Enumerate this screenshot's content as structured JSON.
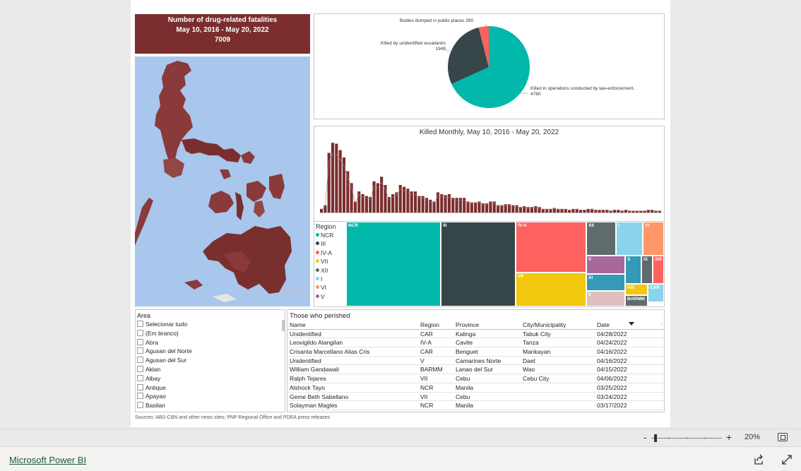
{
  "title_card": {
    "line1": "Number of drug-related fatalities",
    "line2": "May 10, 2016 - May 20, 2022",
    "total": "7009"
  },
  "colors": {
    "title_bg": "#7b2d2d",
    "bar": "#7b2d2d",
    "teal": "#01b8aa",
    "dark": "#374649",
    "red": "#fd625e",
    "yellow": "#f2c80f",
    "map_sea": "#a9c6ec"
  },
  "pie": {
    "labels": {
      "public": "Bodies dumped in public places 280",
      "assailant_line1": "Killed by unidentified assailant/s",
      "assailant_line2": "1949",
      "operations_line1": "Killed in operations conducted by law-enforcement..",
      "operations_line2": "4780"
    }
  },
  "chart_data": [
    {
      "type": "pie",
      "categories": [
        "Killed in operations conducted by law-enforcement..",
        "Killed by unidentified assailant/s",
        "Bodies dumped in public places"
      ],
      "values": [
        4780,
        1949,
        280
      ],
      "colors": [
        "#01b8aa",
        "#374649",
        "#fd625e"
      ]
    },
    {
      "type": "bar",
      "title": "Killed Monthly, May 10, 2016 - May 20, 2022",
      "values": [
        20,
        40,
        325,
        380,
        375,
        340,
        300,
        225,
        160,
        60,
        115,
        100,
        90,
        85,
        170,
        160,
        195,
        150,
        85,
        100,
        110,
        150,
        140,
        130,
        115,
        115,
        90,
        90,
        80,
        70,
        60,
        110,
        100,
        95,
        100,
        80,
        80,
        80,
        80,
        60,
        55,
        55,
        60,
        50,
        50,
        60,
        60,
        40,
        40,
        45,
        45,
        40,
        40,
        30,
        35,
        30,
        30,
        35,
        30,
        20,
        20,
        20,
        25,
        20,
        20,
        20,
        15,
        20,
        20,
        15,
        15,
        20,
        20,
        15,
        15,
        15,
        15,
        10,
        15,
        15,
        10,
        15,
        10,
        10,
        10,
        10,
        10,
        15,
        15,
        10,
        10
      ],
      "series": [
        {
          "values": [
            20,
            40,
            325,
            380,
            375,
            340,
            300,
            225,
            160,
            60,
            115,
            100,
            90,
            85,
            170,
            160,
            195,
            150,
            85,
            100,
            110,
            150,
            140,
            130,
            115,
            115,
            90,
            90,
            80,
            70,
            60,
            110,
            100,
            95,
            100,
            80,
            80,
            80,
            80,
            60,
            55,
            55,
            60,
            50,
            50,
            60,
            60,
            40,
            40,
            45,
            45,
            40,
            40,
            30,
            35,
            30,
            30,
            35,
            30,
            20,
            20,
            20,
            25,
            20,
            20,
            20,
            15,
            20,
            20,
            15,
            15,
            20,
            20,
            15,
            15,
            15,
            15,
            10,
            15,
            15,
            10,
            15,
            10,
            10,
            10,
            10,
            10,
            15,
            15,
            10,
            10
          ]
        }
      ],
      "ylim": [
        0,
        400
      ]
    },
    {
      "type": "treemap",
      "categories": [
        "NCR",
        "III",
        "IV-A",
        "VII",
        "XII",
        "I",
        "VI",
        "V",
        "X",
        "IX",
        "XIII",
        "XI",
        "VIII",
        "CAR",
        "II",
        "BARMM"
      ]
    }
  ],
  "treemap": {
    "legend_title": "Region",
    "legend": [
      {
        "label": "NCR",
        "color": "#01b8aa"
      },
      {
        "label": "III",
        "color": "#374649"
      },
      {
        "label": "IV-A",
        "color": "#fd625e"
      },
      {
        "label": "VII",
        "color": "#f2c80f"
      },
      {
        "label": "XII",
        "color": "#5f6b6d"
      },
      {
        "label": "I",
        "color": "#8ad4eb"
      },
      {
        "label": "VI",
        "color": "#fe9666"
      },
      {
        "label": "V",
        "color": "#a66999"
      }
    ],
    "cells": [
      "NCR",
      "III",
      "IV-A",
      "VII",
      "XII",
      "I",
      "VI",
      "V",
      "X",
      "IX",
      "XIII",
      "XI",
      "VIII",
      "CAR",
      "II",
      "BARMM"
    ]
  },
  "area_slicer": {
    "title": "Area",
    "items": [
      "Selecionar tudo",
      "(Em branco)",
      "Abra",
      "Agusan del Norte",
      "Agusan del Sur",
      "Aklan",
      "Albay",
      "Antique",
      "Apayao",
      "Basilan"
    ]
  },
  "table": {
    "title": "Those who perished",
    "headers": [
      "Name",
      "Region",
      "Province",
      "City/Municipality",
      "Date"
    ],
    "rows": [
      [
        "Unidentified",
        "CAR",
        "Kalinga",
        "Tabuk City",
        "04/28/2022"
      ],
      [
        "Leovigildo Alangilan",
        "IV-A",
        "Cavite",
        "Tanza",
        "04/24/2022"
      ],
      [
        "Crisanta Marcellano Alias Cris",
        "CAR",
        "Benguet",
        "Mankayan",
        "04/16/2022"
      ],
      [
        "Unidentified",
        "V",
        "Camarines Norte",
        "Daet",
        "04/16/2022"
      ],
      [
        "William Gandawali",
        "BARMM",
        "Lanao del Sur",
        "Wao",
        "04/15/2022"
      ],
      [
        "Ralph Tejares",
        "VII",
        "Cebu",
        "Cebu City",
        "04/06/2022"
      ],
      [
        "Alshock Tayo",
        "NCR",
        "Manila",
        "",
        "03/25/2022"
      ],
      [
        "Geme Beth Sabellano",
        "VII",
        "Cebu",
        "",
        "03/24/2022"
      ],
      [
        "Solayman Magles",
        "NCR",
        "Manila",
        "",
        "03/17/2022"
      ]
    ]
  },
  "sources": "Sources: ABS-CBN and other news sites; PNP Regional Office and PDEA press releases",
  "zoom": {
    "minus": "-",
    "plus": "+",
    "percent": "20%"
  },
  "footer": {
    "brand": "Microsoft Power BI"
  }
}
